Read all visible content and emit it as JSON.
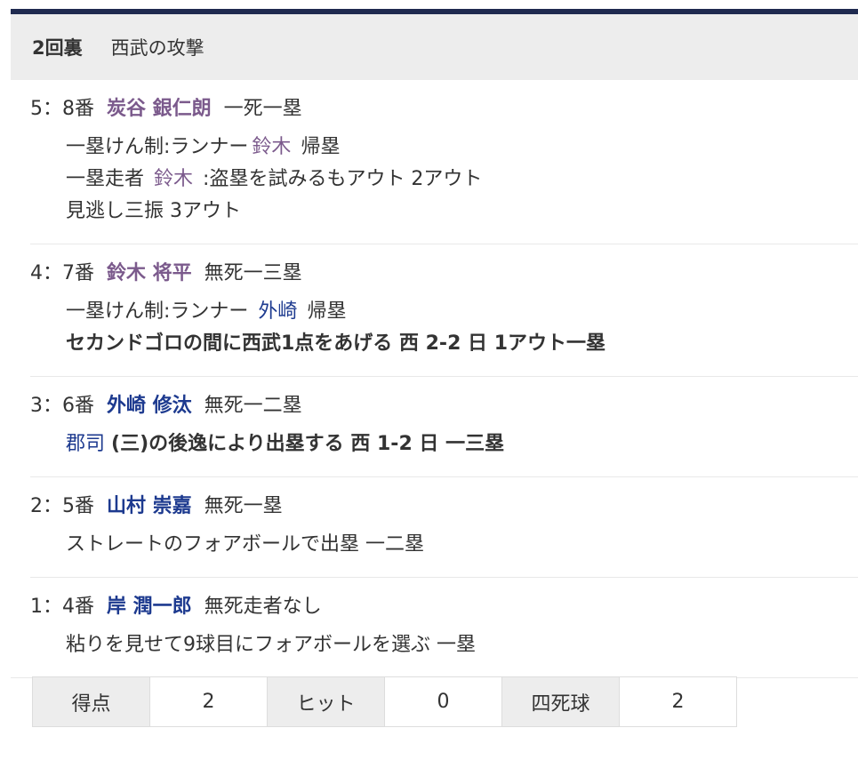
{
  "header": {
    "inning": "2回裏",
    "title": "西武の攻撃"
  },
  "entries": [
    {
      "pa": "5：8番",
      "player": "炭谷 銀仁朗",
      "player_color": "#7b5a8c",
      "situation": "一死一塁",
      "details": [
        {
          "pre": "一塁けん制:ランナー",
          "runner": "鈴木",
          "post": "帰塁"
        },
        {
          "pre": "一塁走者",
          "runner": "鈴木",
          "post": ":盗塁を試みるもアウト 2アウト"
        },
        {
          "pre": "見逃し三振 3アウト"
        }
      ]
    },
    {
      "pa": "4：7番",
      "player": "鈴木 将平",
      "player_color": "#7b5a8c",
      "situation": "無死一三塁",
      "details": [
        {
          "pre": "一塁けん制:ランナー",
          "runner": "外崎",
          "post": "帰塁"
        },
        {
          "pre": "セカンドゴロの間に西武1点をあげる 西 2-2 日 1アウト一塁"
        }
      ]
    },
    {
      "pa": "3：6番",
      "player": "外崎 修汰",
      "player_color": "#1d3a8f",
      "situation": "無死一二塁",
      "details": [
        {
          "runner": "郡司",
          "post": "(三)の後逸により出塁する 西 1-2 日 一三塁"
        }
      ]
    },
    {
      "pa": "2：5番",
      "player": "山村 崇嘉",
      "player_color": "#1d3a8f",
      "situation": "無死一塁",
      "details": [
        {
          "pre": "ストレートのフォアボールで出塁 一二塁"
        }
      ]
    },
    {
      "pa": "1：4番",
      "player": "岸 潤一郎",
      "player_color": "#1d3a8f",
      "situation": "無死走者なし",
      "details": [
        {
          "pre": "粘りを見せて9球目にフォアボールを選ぶ 一塁"
        }
      ]
    }
  ],
  "stats": {
    "runs_label": "得点",
    "runs": "2",
    "hits_label": "ヒット",
    "hits": "0",
    "walks_label": "四死球",
    "walks": "2"
  },
  "colors": {
    "blue_runner": "#1d3a8f",
    "purple_runner": "#7b5a8c",
    "header_bar": "#1f2a4f"
  }
}
